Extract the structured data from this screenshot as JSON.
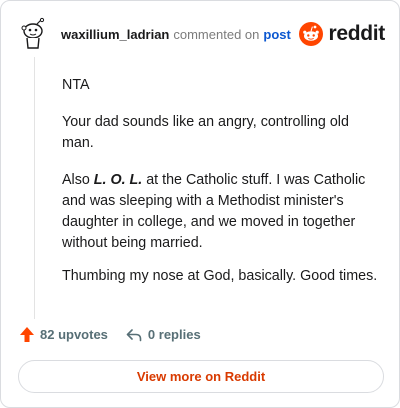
{
  "header": {
    "username": "waxillium_ladrian",
    "action_text": "commented on",
    "post_link": "post",
    "brand_name": "reddit",
    "icons": {
      "avatar": "snoo-avatar-icon",
      "brand": "reddit-snoo-icon"
    }
  },
  "comment": {
    "paragraphs": {
      "p1": "NTA",
      "p2": "Your dad sounds like an angry, controlling old man.",
      "p3_prefix": "Also ",
      "p3_lol": "L. O. L.",
      "p3_rest": " at the Catholic stuff. I was Catholic and was sleeping with a Methodist minister's daughter in college, and we moved in together without being married.",
      "p4": "Thumbing my nose at God, basically. Good times."
    }
  },
  "footer": {
    "upvotes": "82 upvotes",
    "replies": "0 replies",
    "icons": {
      "upvote": "upvote-arrow-icon",
      "reply": "reply-arrow-icon"
    }
  },
  "cta": {
    "label": "View more on Reddit"
  },
  "colors": {
    "accent": "#ff4500",
    "cta_text": "#d93a00",
    "link": "#0b57d0",
    "muted": "#7c7c7c"
  }
}
